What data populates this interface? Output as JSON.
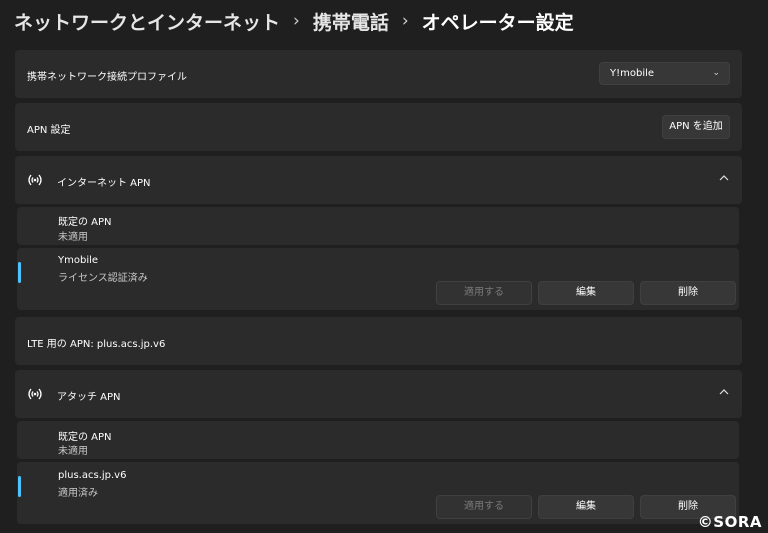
{
  "breadcrumb": {
    "level1": "ネットワークとインターネット",
    "level2": "携帯電話",
    "current": "オペレーター設定",
    "separator": "›"
  },
  "profile": {
    "label": "携帯ネットワーク接続プロファイル",
    "value": "Y!mobile"
  },
  "apn_settings": {
    "label": "APN 設定",
    "add_button": "APN を追加"
  },
  "internet_apn": {
    "title": "インターネット APN",
    "default": {
      "name": "既定の APN",
      "status": "未適用"
    },
    "entry": {
      "name": "Ymobile",
      "status": "ライセンス認証済み",
      "apply": "適用する",
      "edit": "編集",
      "delete": "削除"
    }
  },
  "lte_apn": {
    "label": "LTE 用の APN: plus.acs.jp.v6"
  },
  "attach_apn": {
    "title": "アタッチ APN",
    "default": {
      "name": "既定の APN",
      "status": "未適用"
    },
    "entry": {
      "name": "plus.acs.jp.v6",
      "status": "適用済み",
      "apply": "適用する",
      "edit": "編集",
      "delete": "削除"
    }
  },
  "watermark": "©SORA",
  "colors": {
    "background": "#1f1f1f",
    "card": "#2b2b2b",
    "accent": "#4cc2ff"
  }
}
